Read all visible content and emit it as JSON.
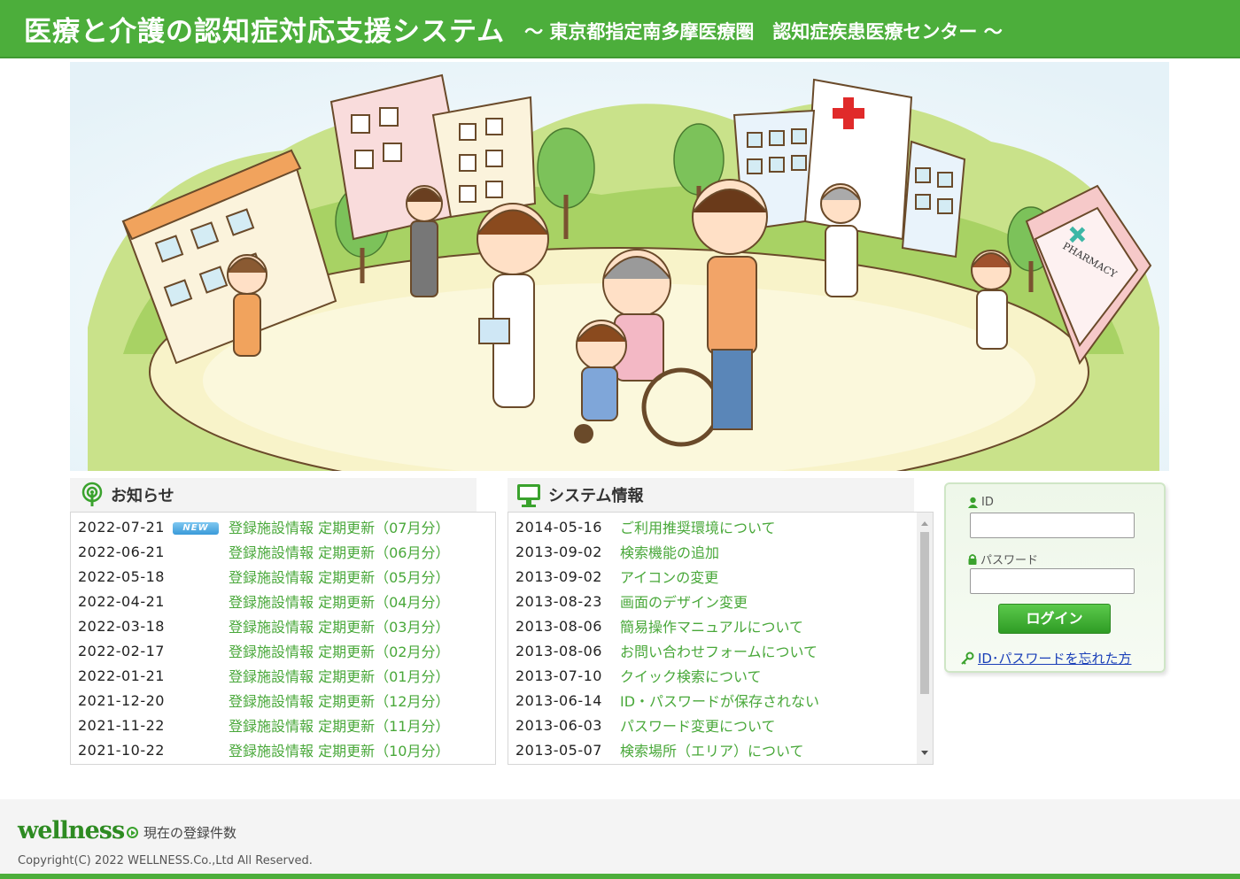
{
  "header": {
    "title": "医療と介護の認知症対応支援システム",
    "subtitle": "～ 東京都指定南多摩医療圏　認知症疾患医療センター ～"
  },
  "hero": {
    "pharmacy_sign": "PHARMACY"
  },
  "news": {
    "title": "お知らせ",
    "new_badge": "NEW",
    "items": [
      {
        "date": "2022-07-21",
        "text": "登録施設情報 定期更新（07月分）"
      },
      {
        "date": "2022-06-21",
        "text": "登録施設情報 定期更新（06月分）"
      },
      {
        "date": "2022-05-18",
        "text": "登録施設情報 定期更新（05月分）"
      },
      {
        "date": "2022-04-21",
        "text": "登録施設情報 定期更新（04月分）"
      },
      {
        "date": "2022-03-18",
        "text": "登録施設情報 定期更新（03月分）"
      },
      {
        "date": "2022-02-17",
        "text": "登録施設情報 定期更新（02月分）"
      },
      {
        "date": "2022-01-21",
        "text": "登録施設情報 定期更新（01月分）"
      },
      {
        "date": "2021-12-20",
        "text": "登録施設情報 定期更新（12月分）"
      },
      {
        "date": "2021-11-22",
        "text": "登録施設情報 定期更新（11月分）"
      },
      {
        "date": "2021-10-22",
        "text": "登録施設情報 定期更新（10月分）"
      }
    ]
  },
  "system": {
    "title": "システム情報",
    "items": [
      {
        "date": "2014-05-16",
        "text": "ご利用推奨環境について"
      },
      {
        "date": "2013-09-02",
        "text": "検索機能の追加"
      },
      {
        "date": "2013-09-02",
        "text": "アイコンの変更"
      },
      {
        "date": "2013-08-23",
        "text": "画面のデザイン変更"
      },
      {
        "date": "2013-08-06",
        "text": "簡易操作マニュアルについて"
      },
      {
        "date": "2013-08-06",
        "text": "お問い合わせフォームについて"
      },
      {
        "date": "2013-07-10",
        "text": "クイック検索について"
      },
      {
        "date": "2013-06-14",
        "text": "ID・パスワードが保存されない"
      },
      {
        "date": "2013-06-03",
        "text": "パスワード変更について"
      },
      {
        "date": "2013-05-07",
        "text": "検索場所（エリア）について"
      }
    ]
  },
  "login": {
    "id_label": "ID",
    "password_label": "パスワード",
    "id_value": "",
    "password_value": "",
    "button": "ログイン",
    "forgot": "ID･パスワードを忘れた方"
  },
  "footer": {
    "logo": "wellness",
    "count_link": "現在の登録件数",
    "copyright": "Copyright(C) 2022 WELLNESS.Co.,Ltd All Reserved."
  },
  "colors": {
    "brand_green": "#4cae3b",
    "link_green": "#49a83a",
    "link_blue": "#1a3fb8"
  }
}
